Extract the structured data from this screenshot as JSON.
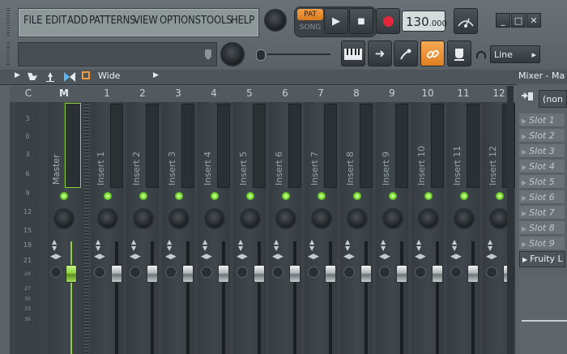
{
  "menu": {
    "file": "FILE",
    "edit": "EDIT",
    "add": "ADD",
    "patterns": "PATTERNS",
    "view": "VIEW",
    "options": "OPTIONS",
    "tools": "TOOLS",
    "help": "HELP"
  },
  "transport": {
    "pat": "PAT",
    "song": "SONG",
    "play_icon": "▶",
    "stop_icon": "■",
    "tempo_main": "130",
    "tempo_frac": ".000"
  },
  "window": {
    "min": "_",
    "max": "□",
    "close": "✕"
  },
  "snap": {
    "value": "Line",
    "arrow": "▸"
  },
  "titlebar": {
    "view_mode": "Wide",
    "title": "Mixer - Ma"
  },
  "mixer": {
    "master_col": "C",
    "master_label": "M",
    "master_name": "Master",
    "scale": [
      "3",
      "0",
      "3",
      "6",
      "9",
      "12",
      "15",
      "18",
      "21",
      "24",
      "27",
      "30",
      "33",
      "36"
    ],
    "inserts": [
      {
        "num": "1",
        "name": "Insert 1"
      },
      {
        "num": "2",
        "name": "Insert 2"
      },
      {
        "num": "3",
        "name": "Insert 3"
      },
      {
        "num": "4",
        "name": "Insert 4"
      },
      {
        "num": "5",
        "name": "Insert 5"
      },
      {
        "num": "6",
        "name": "Insert 6"
      },
      {
        "num": "7",
        "name": "Insert 7"
      },
      {
        "num": "8",
        "name": "Insert 8"
      },
      {
        "num": "9",
        "name": "Insert 9"
      },
      {
        "num": "10",
        "name": "Insert 10"
      },
      {
        "num": "11",
        "name": "Insert 11"
      },
      {
        "num": "12",
        "name": "Insert 12"
      }
    ]
  },
  "right_panel": {
    "input": "(non",
    "slots": [
      "Slot 1",
      "Slot 2",
      "Slot 3",
      "Slot 4",
      "Slot 5",
      "Slot 6",
      "Slot 7",
      "Slot 8",
      "Slot 9"
    ],
    "plugin": "Fruity L"
  },
  "colors": {
    "accent": "#f39a3a",
    "led": "#6bd12c",
    "master_fader": "#8fd13a"
  }
}
